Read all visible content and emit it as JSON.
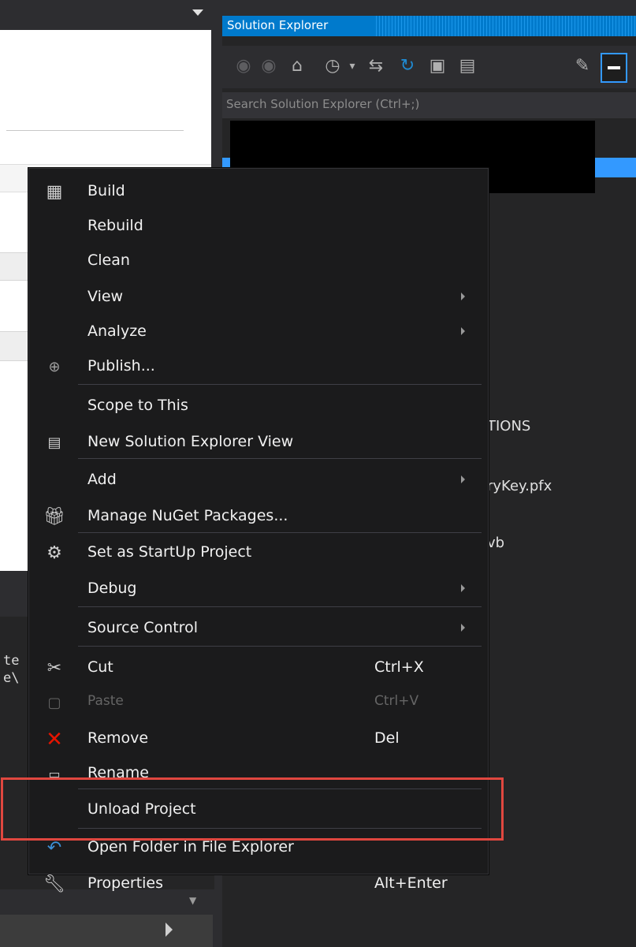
{
  "solution_explorer": {
    "title": "Solution Explorer",
    "search_placeholder": "Search Solution Explorer (Ctrl+;)",
    "tree_fragments": [
      "TIONS",
      "ryKey.pfx",
      "vb"
    ]
  },
  "left_panel": {
    "output_fragments": [
      "te",
      "e\\"
    ]
  },
  "context_menu": {
    "items": [
      {
        "label": "Build",
        "icon": "build-icon"
      },
      {
        "label": "Rebuild"
      },
      {
        "label": "Clean"
      },
      {
        "label": "View",
        "submenu": true
      },
      {
        "label": "Analyze",
        "submenu": true
      },
      {
        "label": "Publish...",
        "icon": "publish-icon"
      },
      {
        "label": "Scope to This"
      },
      {
        "label": "New Solution Explorer View",
        "icon": "new-view-icon"
      },
      {
        "label": "Add",
        "submenu": true
      },
      {
        "label": "Manage NuGet Packages...",
        "icon": "nuget-icon"
      },
      {
        "label": "Set as StartUp Project",
        "icon": "gear-icon"
      },
      {
        "label": "Debug",
        "submenu": true
      },
      {
        "label": "Source Control",
        "submenu": true
      },
      {
        "label": "Cut",
        "shortcut": "Ctrl+X",
        "icon": "scissors-icon"
      },
      {
        "label": "Paste",
        "shortcut": "Ctrl+V",
        "icon": "paste-icon",
        "disabled": true
      },
      {
        "label": "Remove",
        "shortcut": "Del",
        "icon": "remove-x-icon"
      },
      {
        "label": "Rename",
        "icon": "rename-icon"
      },
      {
        "label": "Unload Project",
        "highlighted": true
      },
      {
        "label": "Open Folder in File Explorer",
        "icon": "open-folder-icon"
      },
      {
        "label": "Properties",
        "shortcut": "Alt+Enter",
        "icon": "wrench-icon"
      }
    ]
  },
  "colors": {
    "accent": "#007acc",
    "highlight_box": "#e0473f",
    "remove_icon": "#e51400",
    "menu_bg": "#1b1b1c"
  }
}
